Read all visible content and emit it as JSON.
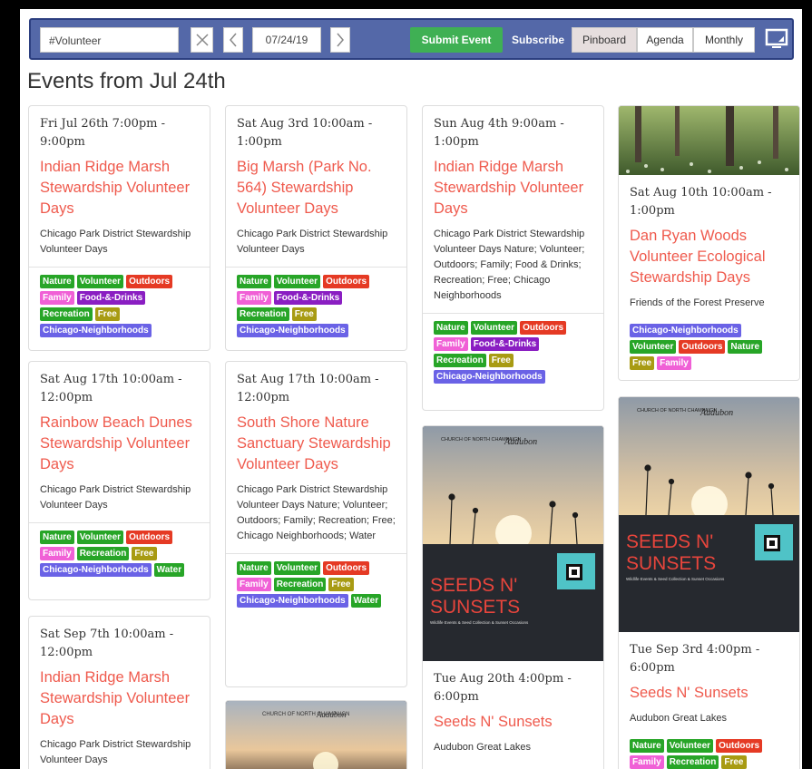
{
  "toolbar": {
    "search_value": "#Volunteer",
    "date_value": "07/24/19",
    "submit_label": "Submit Event",
    "subscribe_label": "Subscribe",
    "views": [
      "Pinboard",
      "Agenda",
      "Monthly"
    ],
    "active_view": "Pinboard",
    "icons": [
      "clear-icon",
      "chevron-left-icon",
      "chevron-right-icon",
      "monitor-icon"
    ]
  },
  "heading": "Events from Jul 24th",
  "colors": {
    "toolbar_bg": "#5468a8",
    "title_red": "#ef5a4d",
    "submit_green": "#3fb054",
    "tag_nature": "#27a527",
    "tag_outdoors": "#e53a24",
    "tag_family": "#f060d6",
    "tag_food": "#8a1ec2",
    "tag_free": "#a89b13",
    "tag_neighborhoods": "#6a62e6"
  },
  "events": [
    {
      "when": "Fri Jul 26th 7:00pm - 9:00pm",
      "title": "Indian Ridge Marsh Stewardship Volunteer Days",
      "desc": "Chicago Park District Stewardship Volunteer Days",
      "tags": [
        "Nature",
        "Volunteer",
        "Outdoors",
        "Family",
        "Food-&-Drinks",
        "Recreation",
        "Free",
        "Chicago-Neighborhoods"
      ]
    },
    {
      "when": "Sat Aug 3rd 10:00am - 1:00pm",
      "title": "Big Marsh (Park No. 564) Stewardship Volunteer Days",
      "desc": "Chicago Park District Stewardship Volunteer Days",
      "tags": [
        "Nature",
        "Volunteer",
        "Outdoors",
        "Family",
        "Food-&-Drinks",
        "Recreation",
        "Free",
        "Chicago-Neighborhoods"
      ]
    },
    {
      "when": "Sun Aug 4th 9:00am - 1:00pm",
      "title": "Indian Ridge Marsh Stewardship Volunteer Days",
      "desc": "Chicago Park District Stewardship Volunteer Days Nature; Volunteer; Outdoors; Family; Food & Drinks; Recreation; Free; Chicago Neighborhoods",
      "tags": [
        "Nature",
        "Volunteer",
        "Outdoors",
        "Family",
        "Food-&-Drinks",
        "Recreation",
        "Free",
        "Chicago-Neighborhoods"
      ]
    },
    {
      "when": "Sat Aug 10th 10:00am - 1:00pm",
      "title": "Dan Ryan Woods Volunteer Ecological Stewardship Days",
      "desc": "Friends of the Forest Preserve",
      "tags": [
        "Chicago-Neighborhoods",
        "Volunteer",
        "Outdoors",
        "Nature",
        "Free",
        "Family"
      ]
    },
    {
      "when": "Sat Aug 17th 10:00am - 12:00pm",
      "title": "Rainbow Beach Dunes Stewardship Volunteer Days",
      "desc": "Chicago Park District Stewardship Volunteer Days",
      "tags": [
        "Nature",
        "Volunteer",
        "Outdoors",
        "Family",
        "Recreation",
        "Free",
        "Chicago-Neighborhoods",
        "Water"
      ]
    },
    {
      "when": "Sat Aug 17th 10:00am - 12:00pm",
      "title": "South Shore Nature Sanctuary Stewardship Volunteer Days",
      "desc": "Chicago Park District Stewardship Volunteer Days Nature; Volunteer; Outdoors; Family; Recreation; Free; Chicago Neighborhoods; Water",
      "tags": [
        "Nature",
        "Volunteer",
        "Outdoors",
        "Family",
        "Recreation",
        "Free",
        "Chicago-Neighborhoods",
        "Water"
      ]
    },
    {
      "when": "Tue Aug 20th 4:00pm - 6:00pm",
      "title": "Seeds N' Sunsets",
      "desc": "Audubon Great Lakes",
      "tags": []
    },
    {
      "when": "Tue Sep 3rd 4:00pm - 6:00pm",
      "title": "Seeds N' Sunsets",
      "desc": "Audubon Great Lakes",
      "tags": [
        "Nature",
        "Volunteer",
        "Outdoors",
        "Family",
        "Recreation",
        "Free"
      ]
    },
    {
      "when": "Sat Sep 7th 10:00am - 12:00pm",
      "title": "Indian Ridge Marsh Stewardship Volunteer Days",
      "desc": "Chicago Park District Stewardship Volunteer Days",
      "tags": []
    }
  ],
  "poster": {
    "headline": "SEEDS N' SUNSETS",
    "line1": "SEEDS N'",
    "line2": "SUNSETS",
    "subtitle": "Wildlife Events & Seed Collection & Sunset Occasions",
    "logo_left": "CHURCH OF NORTH CHAMPAIGN",
    "logo_right": "Audubon"
  }
}
